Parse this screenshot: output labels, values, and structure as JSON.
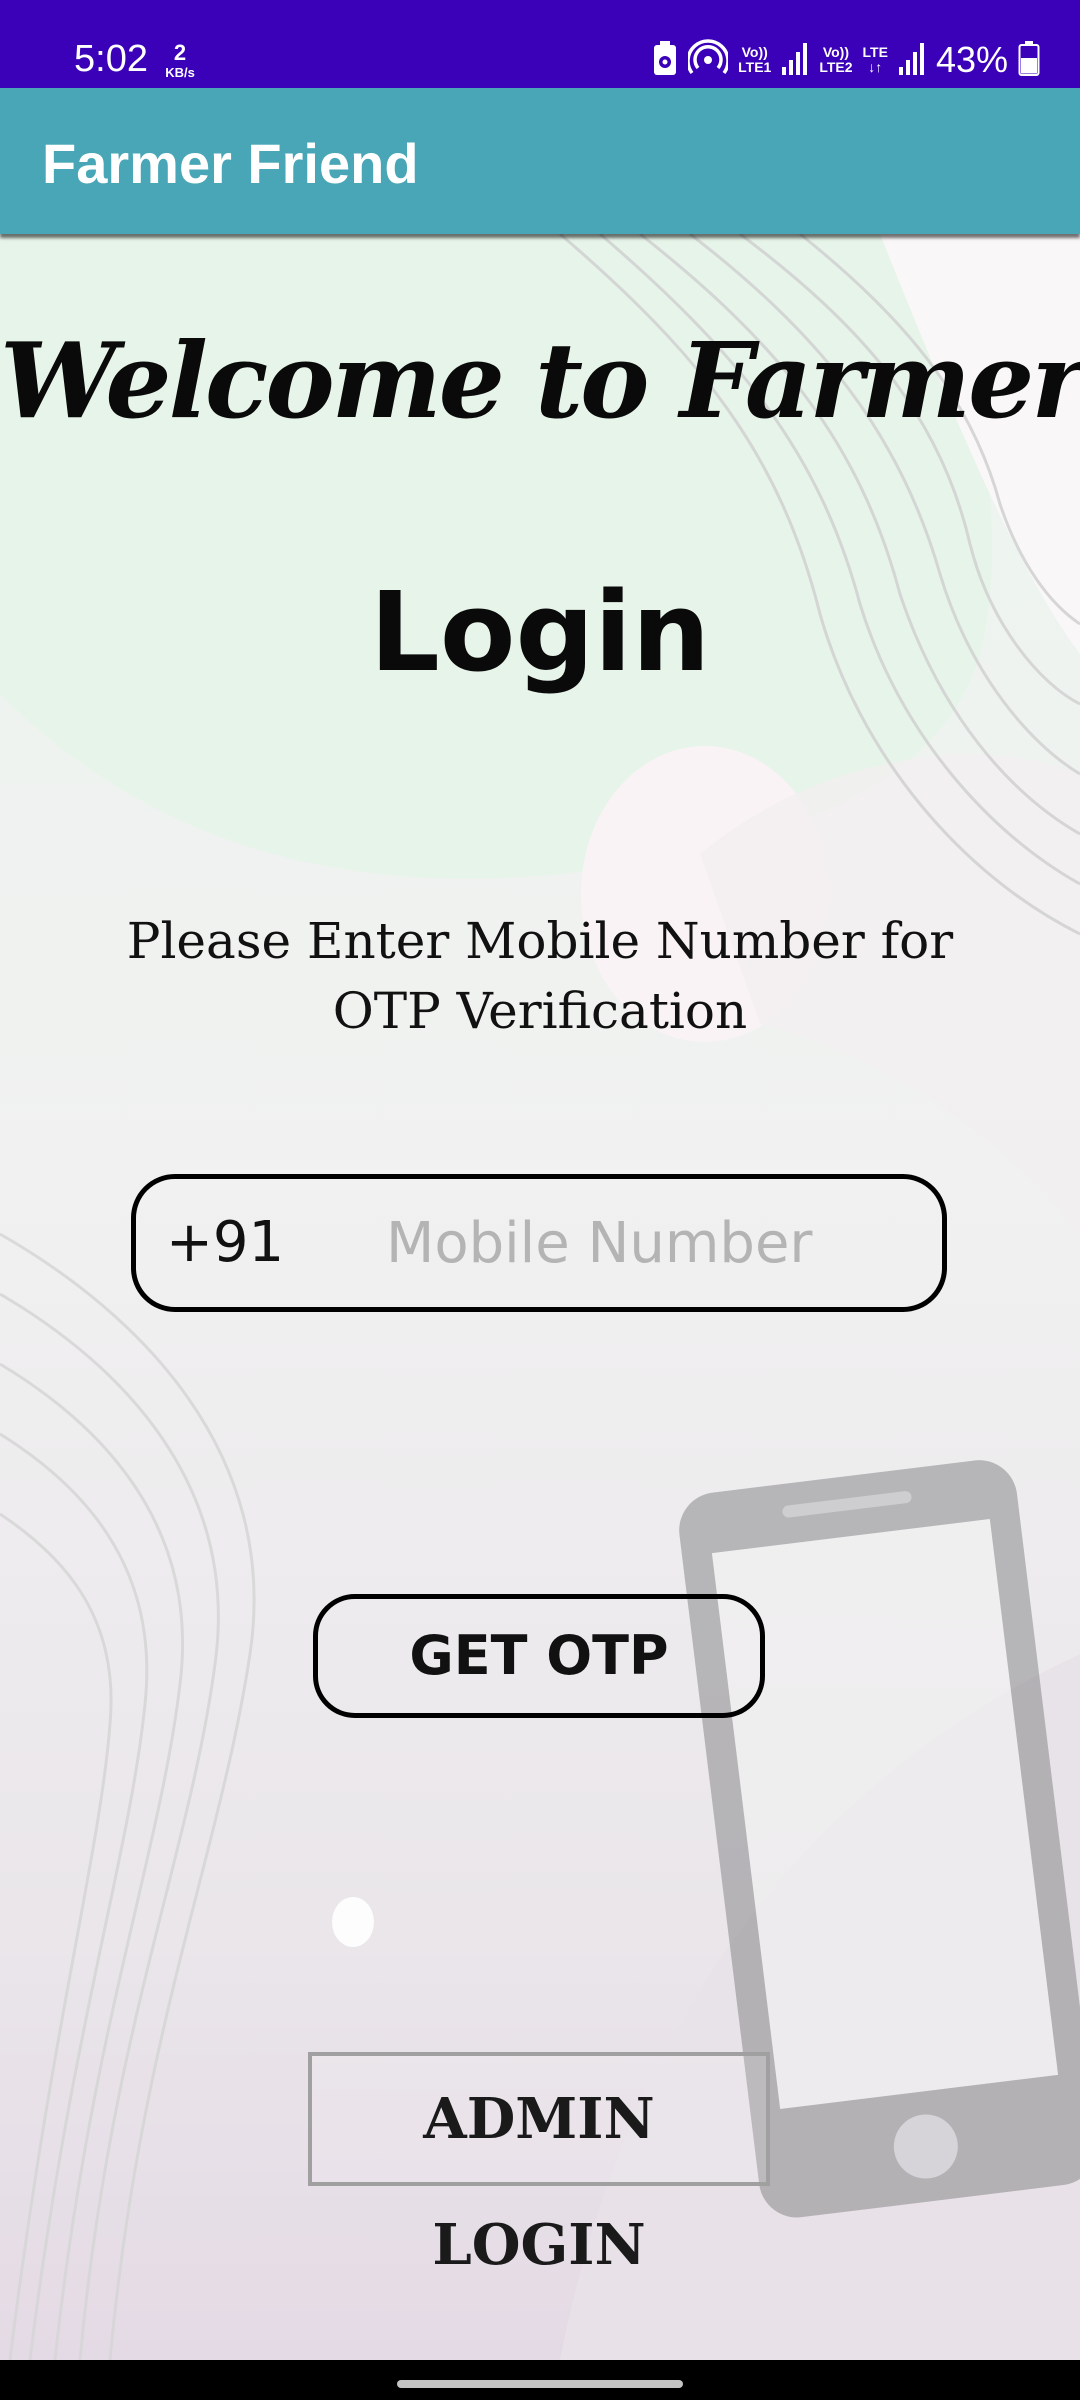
{
  "status_bar": {
    "time": "5:02",
    "net_speed_value": "2",
    "net_speed_unit": "KB/s",
    "sim1_label_top": "Vo))",
    "sim1_label_bottom": "LTE1",
    "sim2_label_top": "Vo))",
    "sim2_label_bottom": "LTE2",
    "data_label": "LTE",
    "battery_percent": "43%",
    "icons": [
      "battery-saver-icon",
      "hotspot-icon",
      "signal-icon",
      "battery-icon"
    ]
  },
  "app_bar": {
    "title": "Farmer Friend",
    "color": "#48a6b6"
  },
  "main": {
    "welcome_text": "Welcome to Farmer Friend",
    "login_heading": "Login",
    "instruction": "Please Enter Mobile Number for OTP Verification",
    "country_code": "+91",
    "mobile_placeholder": "Mobile Number",
    "mobile_value": "",
    "get_otp_label": "GET OTP",
    "admin_login_label": "ADMIN LOGIN",
    "illustration": "smartphone-illustration"
  },
  "colors": {
    "status_bar": "#3a01b8",
    "accent": "#48a6b6"
  }
}
